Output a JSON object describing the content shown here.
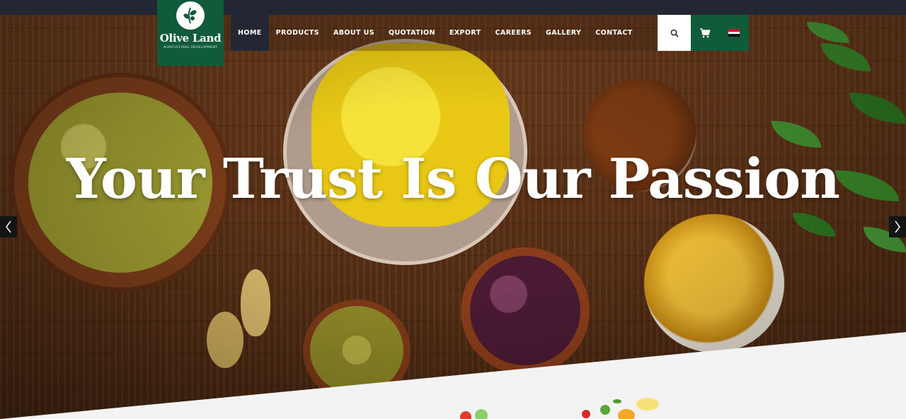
{
  "brand": {
    "name": "Olive Land",
    "tagline": "AGRICULTURAL DEVELOPMENT",
    "color": "#0f5b3a"
  },
  "nav": {
    "items": [
      {
        "label": "HOME",
        "active": true
      },
      {
        "label": "PRODUCTS",
        "active": false
      },
      {
        "label": "ABOUT US",
        "active": false
      },
      {
        "label": "QUOTATION",
        "active": false
      },
      {
        "label": "EXPORT",
        "active": false
      },
      {
        "label": "CAREERS",
        "active": false
      },
      {
        "label": "GALLERY",
        "active": false
      },
      {
        "label": "CONTACT",
        "active": false
      }
    ]
  },
  "actions": {
    "search_icon": "search-icon",
    "cart_icon": "cart-icon",
    "language_icon": "egypt-flag-icon"
  },
  "hero": {
    "headline": "Your Trust Is Our Passion",
    "prev_icon": "chevron-left-icon",
    "next_icon": "chevron-right-icon"
  },
  "colors": {
    "topbar": "#222733",
    "active_nav": "#222733",
    "accent_green": "#0f5b3a"
  }
}
